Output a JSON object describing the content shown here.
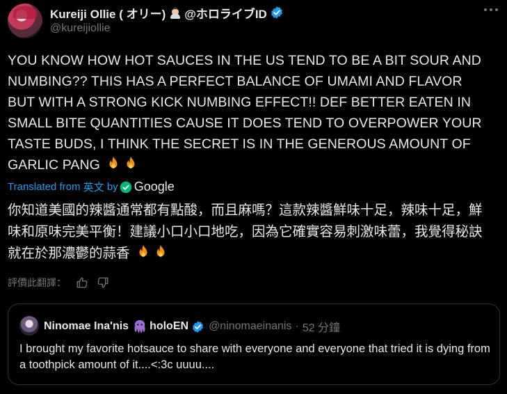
{
  "author": {
    "display_name": "Kureiji Ollie ( オリー)",
    "org_tag": "@ホロライブID",
    "handle": "@kureijiollie",
    "icons": [
      "person-emoji-icon",
      "verified-badge-icon"
    ]
  },
  "tweet": {
    "text": "YOU KNOW HOW HOT SAUCES IN THE US TEND TO BE A BIT SOUR AND NUMBING?? THIS HAS A PERFECT BALANCE OF UMAMI AND FLAVOR BUT WITH A STRONG KICK NUMBING EFFECT!! DEF BETTER EATEN IN SMALL BITE QUANTITIES CAUSE IT DOES TEND TO OVERPOWER YOUR TASTE BUDS, I THINK THE SECRET IS IN THE GENEROUS AMOUNT OF GARLIC PANG"
  },
  "translation": {
    "label_prefix": "Translated from",
    "source_language": "英文",
    "by": "by",
    "provider": "Google",
    "text": "你知道美國的辣醬通常都有點酸，而且麻嗎？這款辣醬鮮味十足，辣味十足，鮮味和原味完美平衡！建議小口小口地吃，因為它確實容易刺激味蕾，我覺得秘訣就在於那濃鬱的蒜香",
    "rate_label": "評價此翻譯："
  },
  "quote": {
    "display_name": "Ninomae Ina'nis",
    "org_tag": "holoEN",
    "handle": "@ninomaeinanis",
    "separator": "·",
    "time": "52 分鐘",
    "text": "I brought my favorite hotsauce to share with everyone and everyone that tried it is dying from a toothpick amount of it....<:3c uuuu...."
  },
  "colors": {
    "background": "#000000",
    "text": "#e7e9ea",
    "muted": "#71767b",
    "link": "#1d9bf0",
    "verified": "#1d9bf0",
    "border": "#2f3336"
  }
}
